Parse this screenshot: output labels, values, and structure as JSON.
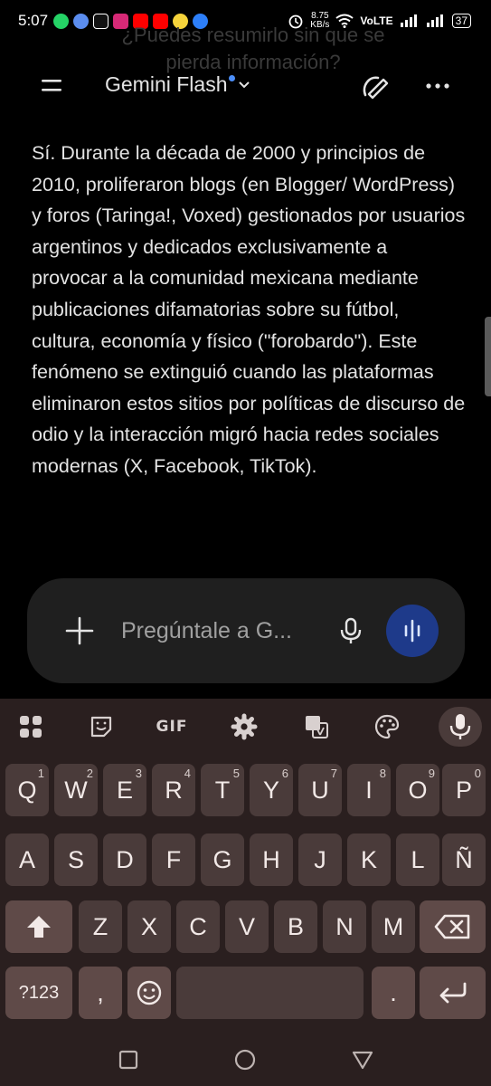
{
  "status_bar": {
    "time": "5:07",
    "speed_value": "8.75",
    "speed_unit": "KB/s",
    "network": "VoLTE",
    "battery": "37"
  },
  "previous_message": "¿Puedes resumirlo sin que se pierda información?",
  "header": {
    "model_name": "Gemini Flash"
  },
  "response_text": "Sí. Durante la década de 2000 y principios de 2010, proliferaron blogs (en Blogger/ WordPress) y foros (Taringa!, Voxed) gestionados por usuarios argentinos y dedicados exclusivamente a provocar a la comunidad mexicana mediante publicaciones difamatorias sobre su fútbol, cultura, economía y físico (\"forobardo\"). Este fenómeno se extinguió cuando las plataformas eliminaron estos sitios por políticas de discurso de odio y la interacción migró hacia redes sociales modernas (X, Facebook, TikTok).",
  "input": {
    "placeholder": "Pregúntale a G..."
  },
  "keyboard": {
    "toolbar_gif": "GIF",
    "row1": [
      {
        "k": "Q",
        "h": "1"
      },
      {
        "k": "W",
        "h": "2"
      },
      {
        "k": "E",
        "h": "3"
      },
      {
        "k": "R",
        "h": "4"
      },
      {
        "k": "T",
        "h": "5"
      },
      {
        "k": "Y",
        "h": "6"
      },
      {
        "k": "U",
        "h": "7"
      },
      {
        "k": "I",
        "h": "8"
      },
      {
        "k": "O",
        "h": "9"
      },
      {
        "k": "P",
        "h": "0"
      }
    ],
    "row2": [
      "A",
      "S",
      "D",
      "F",
      "G",
      "H",
      "J",
      "K",
      "L",
      "Ñ"
    ],
    "row3": [
      "Z",
      "X",
      "C",
      "V",
      "B",
      "N",
      "M"
    ],
    "symbols_key": "?123",
    "comma_key": ",",
    "period_key": "."
  },
  "colors": {
    "accent_blue": "#4b8ef9",
    "live_button": "#1e3a8a",
    "keyboard_bg": "#2a1f1f",
    "key_bg": "#4a3b3a"
  }
}
